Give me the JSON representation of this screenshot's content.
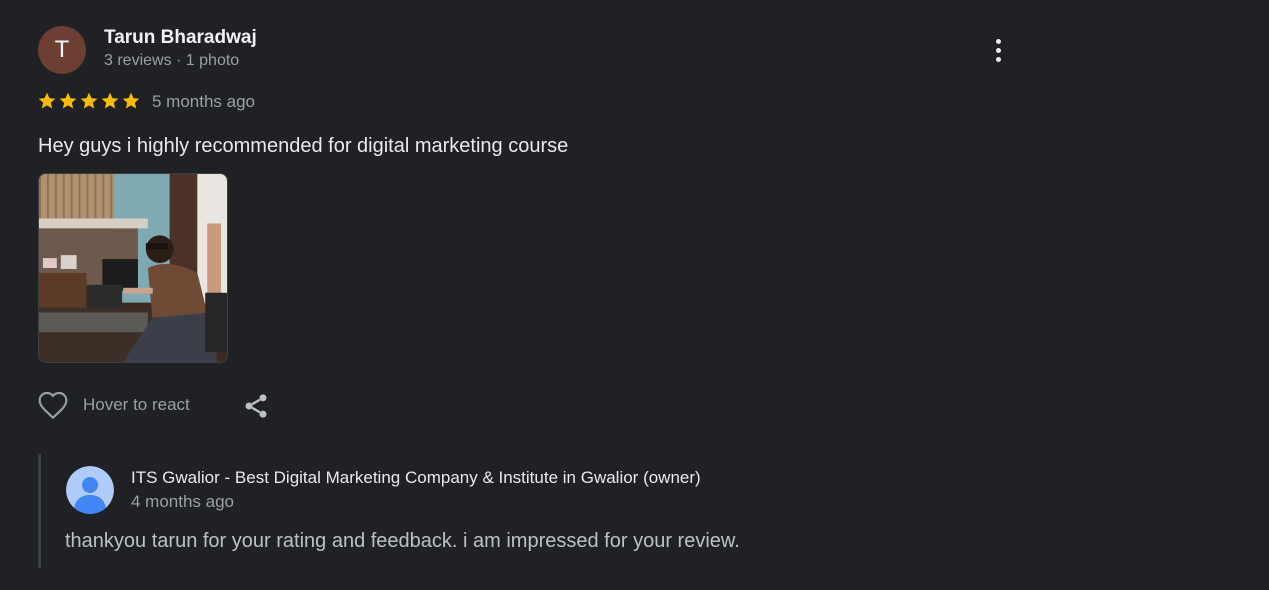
{
  "review": {
    "avatar_letter": "T",
    "reviewer_name": "Tarun Bharadwaj",
    "reviewer_meta": "3 reviews · 1 photo",
    "rating": 5,
    "time": "5 months ago",
    "text": "Hey guys i highly recommended for digital marketing course",
    "react_label": "Hover to react"
  },
  "owner_reply": {
    "name": "ITS Gwalior - Best Digital Marketing Company & Institute in Gwalior (owner)",
    "time": "4 months ago",
    "text": "thankyou tarun for your rating and feedback. i am impressed for your review."
  },
  "icons": [
    "more-vert-icon",
    "star-icon",
    "heart-icon",
    "share-icon",
    "person-icon"
  ],
  "colors": {
    "background": "#202124",
    "star": "#fbbc04",
    "avatar": "#6d3f33",
    "owner_avatar": "#aecbfa"
  }
}
